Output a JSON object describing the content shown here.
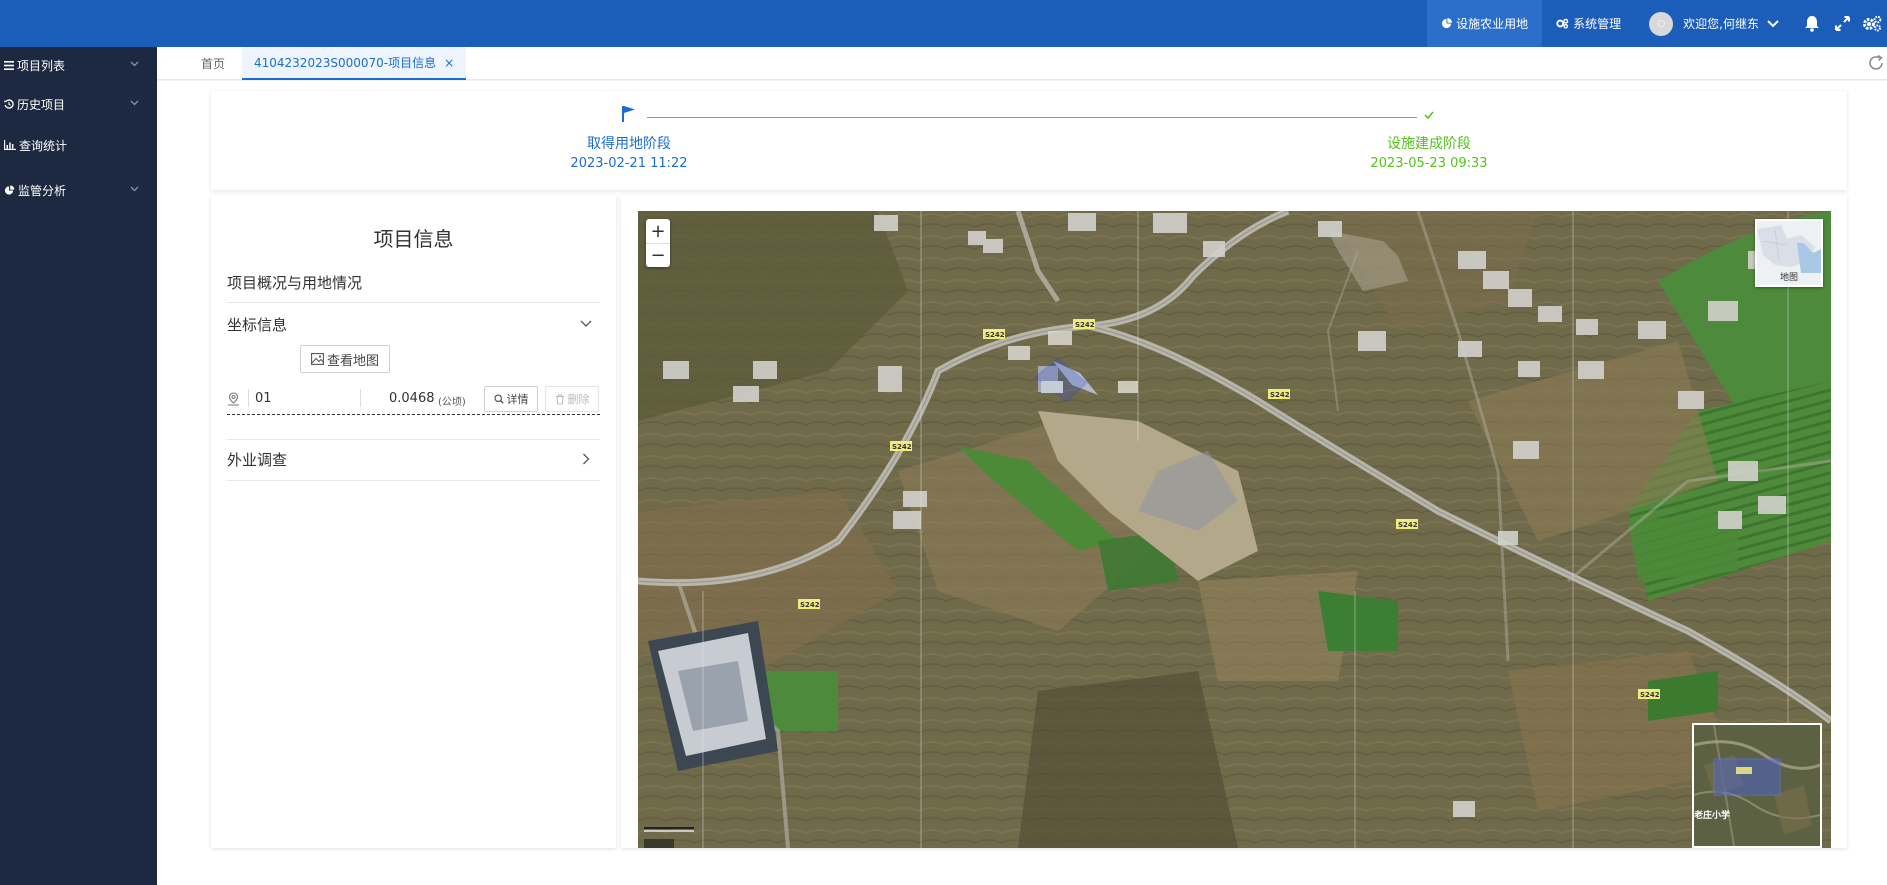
{
  "topbar": {
    "nav": [
      {
        "label": "设施农业用地",
        "icon": "pie-chart-icon",
        "active": true
      },
      {
        "label": "系统管理",
        "icon": "gears-icon",
        "active": false
      }
    ],
    "user_greeting": "欢迎您,何继东"
  },
  "sidebar": {
    "items": [
      {
        "label": "项目列表",
        "icon": "list-icon",
        "has_chevron": true
      },
      {
        "label": "历史项目",
        "icon": "history-icon",
        "has_chevron": true
      },
      {
        "label": "查询统计",
        "icon": "bar-chart-icon",
        "has_chevron": false
      },
      {
        "label": "监管分析",
        "icon": "pie-chart-icon",
        "has_chevron": true
      }
    ]
  },
  "tabs": [
    {
      "label": "首页",
      "active": false
    },
    {
      "label": "4104232023S000070-项目信息",
      "active": true,
      "close": "×"
    }
  ],
  "progress": {
    "steps": [
      {
        "name": "取得用地阶段",
        "time": "2023-02-21 11:22",
        "icon": "flag-icon",
        "color": "#1b6dd1"
      },
      {
        "name": "设施建成阶段",
        "time": "2023-05-23 09:33",
        "icon": "check-icon",
        "color": "#52c41a"
      }
    ]
  },
  "project": {
    "title": "项目信息",
    "overview": "项目概况与用地情况",
    "coord_section": "坐标信息",
    "view_map": "查看地图",
    "parcel": {
      "id": "01",
      "area": "0.0468",
      "unit": "(公顷)"
    },
    "detail_btn": "详情",
    "delete_btn": "删除",
    "field_survey": "外业调查"
  },
  "map": {
    "zoom_in": "+",
    "zoom_out": "−",
    "basemap_label": "地图",
    "road_labels": [
      "S242",
      "S242",
      "S242",
      "S242",
      "S242",
      "S242",
      "S242"
    ],
    "overview_label": "老庄小学"
  },
  "colors": {
    "topbar": "#1b5db8",
    "sidebar": "#1c2940",
    "accent": "#1b6dd1",
    "success": "#52c41a",
    "parcel_outline": "#2740e8"
  }
}
